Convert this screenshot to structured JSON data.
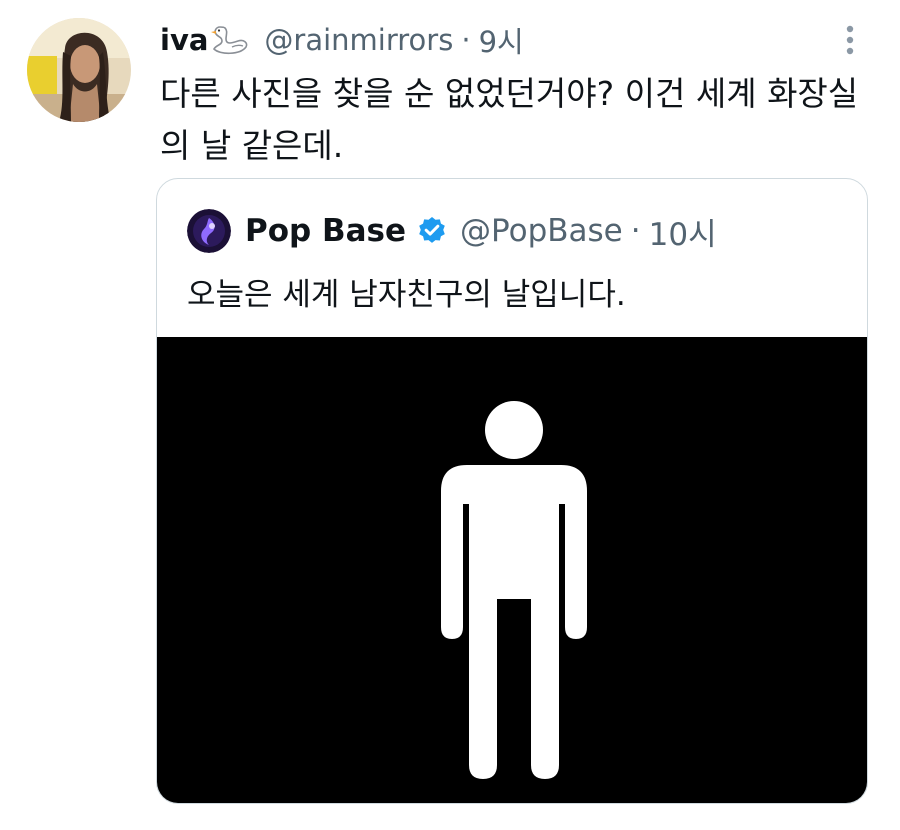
{
  "tweet": {
    "author": {
      "display_name": "iva",
      "name_emoji": "swan-emoji-icon",
      "handle": "@rainmirrors",
      "separator": "·",
      "time": "9시"
    },
    "text": "다른 사진을 찾을 순 없었던거야? 이건 세계 화장실의 날 같은데.",
    "more_icon": "more-vertical-icon"
  },
  "quote": {
    "author": {
      "display_name": "Pop Base",
      "verified_icon": "verified-badge-icon",
      "handle": "@PopBase",
      "separator": "·",
      "time": "10시"
    },
    "text": "오늘은 세계 남자친구의 날입니다.",
    "media": {
      "icon": "male-restroom-figure-icon",
      "background": "#000000",
      "figure_color": "#ffffff"
    }
  },
  "colors": {
    "text_primary": "#0f1419",
    "text_secondary": "#536471",
    "card_border": "#cfd9de",
    "verified_blue": "#1d9bf0"
  }
}
